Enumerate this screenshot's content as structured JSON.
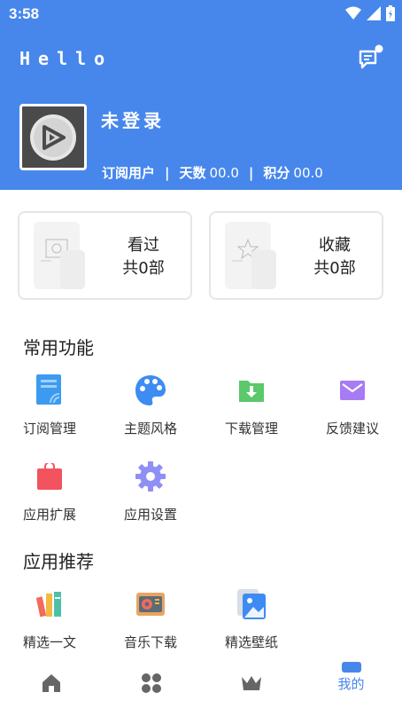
{
  "status_bar": {
    "time": "3:58"
  },
  "header": {
    "app_title": "Hello",
    "username": "未登录",
    "stats": {
      "user_type": "订阅用户",
      "days_label": "天数",
      "days_value": "00.0",
      "points_label": "积分",
      "points_value": "00.0"
    }
  },
  "cards": {
    "watched": {
      "title": "看过",
      "count": "共0部"
    },
    "favorites": {
      "title": "收藏",
      "count": "共0部"
    }
  },
  "common_functions": {
    "title": "常用功能",
    "items": [
      {
        "label": "订阅管理",
        "icon": "subscription-icon",
        "color": "#3C9BF0"
      },
      {
        "label": "主题风格",
        "icon": "palette-icon",
        "color": "#3C8CF2"
      },
      {
        "label": "下载管理",
        "icon": "download-folder-icon",
        "color": "#5BC86A"
      },
      {
        "label": "反馈建议",
        "icon": "mail-icon",
        "color": "#A77BF3"
      },
      {
        "label": "应用扩展",
        "icon": "shopping-bag-icon",
        "color": "#F2535F"
      },
      {
        "label": "应用设置",
        "icon": "gear-icon",
        "color": "#8F8FF5"
      }
    ]
  },
  "app_recommend": {
    "title": "应用推荐",
    "items": [
      {
        "label": "精选一文",
        "icon": "books-icon"
      },
      {
        "label": "音乐下载",
        "icon": "radio-icon"
      },
      {
        "label": "精选壁纸",
        "icon": "wallpaper-icon"
      }
    ]
  },
  "bottom_nav": {
    "items": [
      {
        "icon": "home-icon"
      },
      {
        "icon": "apps-icon"
      },
      {
        "icon": "crown-icon"
      },
      {
        "icon": "profile-icon",
        "label": "我的",
        "active": true
      }
    ]
  },
  "colors": {
    "primary": "#4787EC",
    "inactive_nav": "#666666"
  }
}
